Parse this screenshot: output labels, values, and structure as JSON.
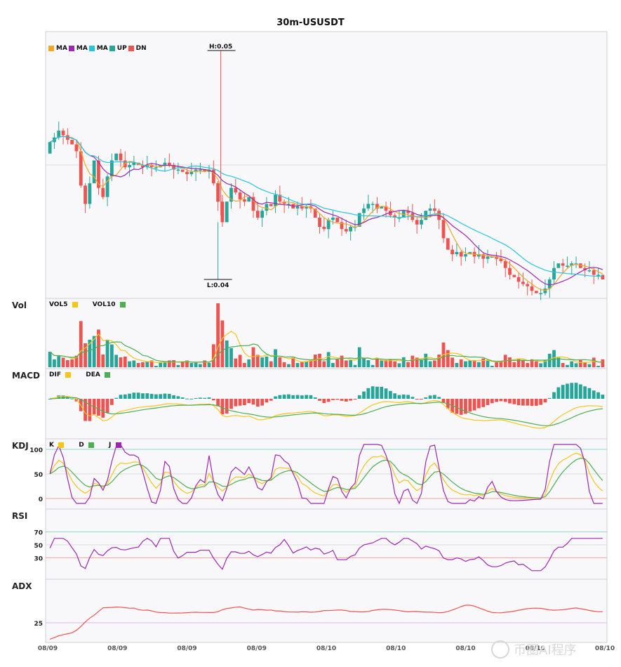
{
  "chart_data": {
    "type": "candlestick",
    "title": "30m-USUSDT",
    "x_ticks": [
      "08/09",
      "08/09",
      "08/09",
      "08/09",
      "08/10",
      "08/10",
      "08/10",
      "08/10",
      "08/10"
    ],
    "price": {
      "legend": [
        {
          "name": "MA",
          "color": "#f5a623"
        },
        {
          "name": "MA",
          "color": "#9c27b0"
        },
        {
          "name": "MA",
          "color": "#26c6da"
        },
        {
          "name": "UP",
          "color": "#26a69a"
        },
        {
          "name": "DN",
          "color": "#ef5350"
        }
      ],
      "max_label": "H:0.05",
      "min_label": "L:0.04",
      "high": 0.05,
      "low": 0.04,
      "closes": [
        0.046,
        0.0462,
        0.0465,
        0.0463,
        0.0461,
        0.0459,
        0.0456,
        0.0441,
        0.0433,
        0.0442,
        0.0452,
        0.044,
        0.0436,
        0.0445,
        0.0452,
        0.0455,
        0.0452,
        0.0449,
        0.045,
        0.0451,
        0.045,
        0.0449,
        0.045,
        0.0449,
        0.0449,
        0.045,
        0.0451,
        0.045,
        0.0448,
        0.0448,
        0.0447,
        0.0446,
        0.0447,
        0.0448,
        0.0448,
        0.0447,
        0.0448,
        0.0442,
        0.0434,
        0.0425,
        0.0434,
        0.044,
        0.0438,
        0.0435,
        0.0434,
        0.0436,
        0.043,
        0.0427,
        0.043,
        0.0433,
        0.0432,
        0.0437,
        0.0434,
        0.0433,
        0.0433,
        0.0431,
        0.0432,
        0.0431,
        0.0432,
        0.0431,
        0.0427,
        0.0423,
        0.0422,
        0.0426,
        0.0427,
        0.0425,
        0.0422,
        0.0421,
        0.0423,
        0.0423,
        0.0429,
        0.0431,
        0.0433,
        0.0433,
        0.0431,
        0.0432,
        0.043,
        0.0428,
        0.0427,
        0.0427,
        0.043,
        0.0429,
        0.0426,
        0.0424,
        0.0426,
        0.043,
        0.0431,
        0.043,
        0.0426,
        0.0418,
        0.0413,
        0.0411,
        0.0412,
        0.041,
        0.0411,
        0.0412,
        0.041,
        0.0411,
        0.0409,
        0.041,
        0.041,
        0.0409,
        0.0408,
        0.0405,
        0.0402,
        0.0401,
        0.0399,
        0.0398,
        0.0397,
        0.0395,
        0.0394,
        0.0394,
        0.0396,
        0.04,
        0.0405,
        0.0407,
        0.0406,
        0.0406,
        0.0407,
        0.0407,
        0.0405,
        0.0404,
        0.0404,
        0.0402,
        0.0402,
        0.04
      ],
      "opens": [
        0.0455,
        0.046,
        0.0462,
        0.0465,
        0.0463,
        0.0461,
        0.0459,
        0.0456,
        0.0441,
        0.0433,
        0.0442,
        0.0452,
        0.044,
        0.0436,
        0.0445,
        0.0452,
        0.0455,
        0.0452,
        0.0449,
        0.045,
        0.0451,
        0.045,
        0.0449,
        0.045,
        0.0449,
        0.0449,
        0.045,
        0.0451,
        0.045,
        0.0448,
        0.0448,
        0.0447,
        0.0446,
        0.0447,
        0.0448,
        0.0448,
        0.0447,
        0.0448,
        0.0442,
        0.0434,
        0.0425,
        0.0434,
        0.044,
        0.0438,
        0.0435,
        0.0434,
        0.0436,
        0.043,
        0.0427,
        0.043,
        0.0433,
        0.0432,
        0.0437,
        0.0434,
        0.0433,
        0.0433,
        0.0431,
        0.0432,
        0.0431,
        0.0432,
        0.0431,
        0.0427,
        0.0423,
        0.0422,
        0.0426,
        0.0427,
        0.0425,
        0.0422,
        0.0421,
        0.0423,
        0.0423,
        0.0429,
        0.0431,
        0.0433,
        0.0433,
        0.0431,
        0.0432,
        0.043,
        0.0428,
        0.0427,
        0.0427,
        0.043,
        0.0429,
        0.0426,
        0.0424,
        0.0426,
        0.043,
        0.0431,
        0.043,
        0.0426,
        0.0418,
        0.0413,
        0.0411,
        0.0412,
        0.041,
        0.0411,
        0.0412,
        0.041,
        0.0411,
        0.0409,
        0.041,
        0.041,
        0.0409,
        0.0408,
        0.0405,
        0.0402,
        0.0401,
        0.0399,
        0.0398,
        0.0397,
        0.0395,
        0.0394,
        0.0394,
        0.0396,
        0.04,
        0.0405,
        0.0407,
        0.0406,
        0.0406,
        0.0407,
        0.0407,
        0.0405,
        0.0404,
        0.0404,
        0.0402,
        0.0402
      ]
    },
    "volume": {
      "legend": [
        {
          "name": "VOL5",
          "color": "#f5c518"
        },
        {
          "name": "VOL10",
          "color": "#4caf50"
        }
      ]
    },
    "macd": {
      "legend": [
        {
          "name": "DIF",
          "color": "#f5c518"
        },
        {
          "name": "DEA",
          "color": "#4caf50"
        }
      ]
    },
    "kdj": {
      "legend": [
        {
          "name": "K",
          "color": "#f5c518"
        },
        {
          "name": "D",
          "color": "#4caf50"
        },
        {
          "name": "J",
          "color": "#9c27b0"
        }
      ],
      "ticks": [
        "100",
        "50",
        "0"
      ]
    },
    "rsi": {
      "ticks": [
        "70",
        "50",
        "30"
      ]
    },
    "adx": {
      "ticks": [
        "25"
      ]
    }
  },
  "panels": {
    "vol": "Vol",
    "macd": "MACD",
    "kdj": "KDJ",
    "rsi": "RSI",
    "adx": "ADX"
  },
  "watermark": "币圈AI程序"
}
